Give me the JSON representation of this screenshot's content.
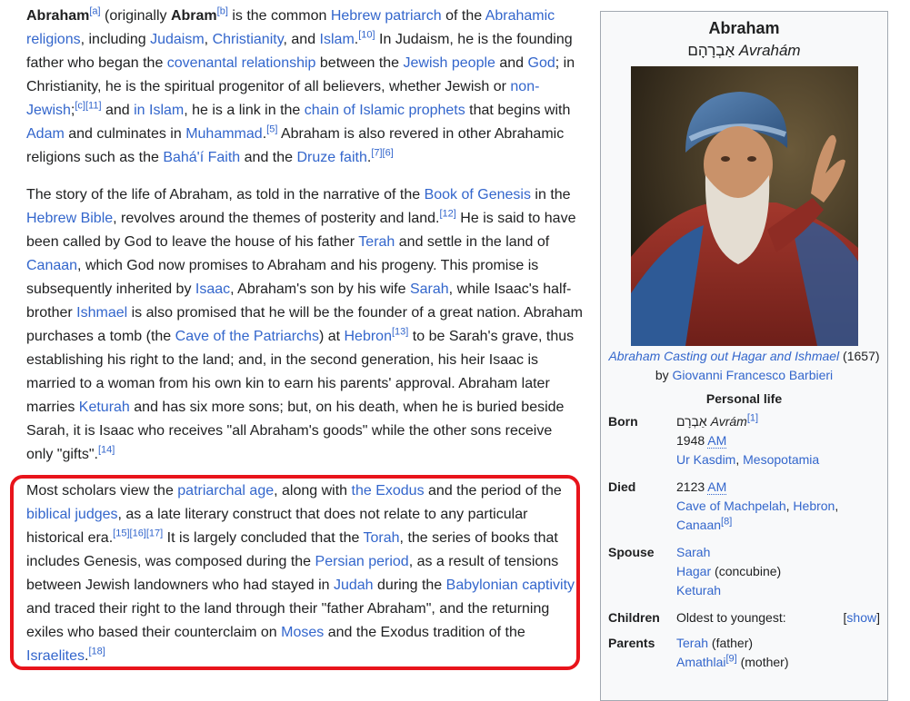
{
  "article": {
    "p1": [
      {
        "t": "Abraham",
        "b": 1
      },
      {
        "t": "[a]",
        "sup": 1,
        "l": 1
      },
      {
        "t": " (originally "
      },
      {
        "t": "Abram",
        "b": 1
      },
      {
        "t": "[b]",
        "sup": 1,
        "l": 1
      },
      {
        "t": " is the common "
      },
      {
        "t": "Hebrew patriarch",
        "l": 1
      },
      {
        "t": " of the "
      },
      {
        "t": "Abrahamic religions",
        "l": 1
      },
      {
        "t": ", including "
      },
      {
        "t": "Judaism",
        "l": 1
      },
      {
        "t": ", "
      },
      {
        "t": "Christianity",
        "l": 1
      },
      {
        "t": ", and "
      },
      {
        "t": "Islam",
        "l": 1
      },
      {
        "t": ".",
        "l": 0
      },
      {
        "t": "[10]",
        "sup": 1,
        "l": 1
      },
      {
        "t": " In Judaism, he is the founding father who began the "
      },
      {
        "t": "covenantal relationship",
        "l": 1
      },
      {
        "t": " between the "
      },
      {
        "t": "Jewish people",
        "l": 1
      },
      {
        "t": " and "
      },
      {
        "t": "God",
        "l": 1
      },
      {
        "t": "; in Christianity, he is the spiritual progenitor of all believers, whether Jewish or "
      },
      {
        "t": "non-Jewish",
        "l": 1
      },
      {
        "t": ";"
      },
      {
        "t": "[c]",
        "sup": 1,
        "l": 1
      },
      {
        "t": "[11]",
        "sup": 1,
        "l": 1
      },
      {
        "t": " and "
      },
      {
        "t": "in Islam",
        "l": 1
      },
      {
        "t": ", he is a link in the "
      },
      {
        "t": "chain of Islamic prophets",
        "l": 1
      },
      {
        "t": " that begins with "
      },
      {
        "t": "Adam",
        "l": 1
      },
      {
        "t": " and culminates in "
      },
      {
        "t": "Muhammad",
        "l": 1
      },
      {
        "t": "."
      },
      {
        "t": "[5]",
        "sup": 1,
        "l": 1
      },
      {
        "t": " Abraham is also revered in other Abrahamic religions such as the "
      },
      {
        "t": "Bahá'í Faith",
        "l": 1
      },
      {
        "t": " and the "
      },
      {
        "t": "Druze faith",
        "l": 1
      },
      {
        "t": "."
      },
      {
        "t": "[7]",
        "sup": 1,
        "l": 1
      },
      {
        "t": "[6]",
        "sup": 1,
        "l": 1
      }
    ],
    "p2": [
      {
        "t": "The story of the life of Abraham, as told in the narrative of the "
      },
      {
        "t": "Book of Genesis",
        "l": 1
      },
      {
        "t": " in the "
      },
      {
        "t": "Hebrew Bible",
        "l": 1
      },
      {
        "t": ", revolves around the themes of posterity and land."
      },
      {
        "t": "[12]",
        "sup": 1,
        "l": 1
      },
      {
        "t": " He is said to have been called by God to leave the house of his father "
      },
      {
        "t": "Terah",
        "l": 1
      },
      {
        "t": " and settle in the land of "
      },
      {
        "t": "Canaan",
        "l": 1
      },
      {
        "t": ", which God now promises to Abraham and his progeny. This promise is subsequently inherited by "
      },
      {
        "t": "Isaac",
        "l": 1
      },
      {
        "t": ", Abraham's son by his wife "
      },
      {
        "t": "Sarah",
        "l": 1
      },
      {
        "t": ", while Isaac's half-brother "
      },
      {
        "t": "Ishmael",
        "l": 1
      },
      {
        "t": " is also promised that he will be the founder of a great nation. Abraham purchases a tomb (the "
      },
      {
        "t": "Cave of the Patriarchs",
        "l": 1
      },
      {
        "t": ") at "
      },
      {
        "t": "Hebron",
        "l": 1
      },
      {
        "t": "[13]",
        "sup": 1,
        "l": 1
      },
      {
        "t": " to be Sarah's grave, thus establishing his right to the land; and, in the second generation, his heir Isaac is married to a woman from his own kin to earn his parents' approval. Abraham later marries "
      },
      {
        "t": "Keturah",
        "l": 1
      },
      {
        "t": " and has six more sons; but, on his death, when he is buried beside Sarah, it is Isaac who receives \"all Abraham's goods\" while the other sons receive only \"gifts\"."
      },
      {
        "t": "[14]",
        "sup": 1,
        "l": 1
      }
    ],
    "p3": [
      {
        "t": "Most scholars view the "
      },
      {
        "t": "patriarchal age",
        "l": 1
      },
      {
        "t": ", along with "
      },
      {
        "t": "the Exodus",
        "l": 1
      },
      {
        "t": " and the period of the "
      },
      {
        "t": "biblical judges",
        "l": 1
      },
      {
        "t": ", as a late literary construct that does not relate to any particular historical era."
      },
      {
        "t": "[15]",
        "sup": 1,
        "l": 1
      },
      {
        "t": "[16]",
        "sup": 1,
        "l": 1
      },
      {
        "t": "[17]",
        "sup": 1,
        "l": 1
      },
      {
        "t": " It is largely concluded that the "
      },
      {
        "t": "Torah",
        "l": 1
      },
      {
        "t": ", the series of books that includes Genesis, was composed during the "
      },
      {
        "t": "Persian period",
        "l": 1
      },
      {
        "t": ", as a result of tensions between Jewish landowners who had stayed in "
      },
      {
        "t": "Judah",
        "l": 1
      },
      {
        "t": " during the "
      },
      {
        "t": "Babylonian captivity",
        "l": 1
      },
      {
        "t": " and traced their right to the land through their \"father Abraham\", and the returning exiles who based their counterclaim on "
      },
      {
        "t": "Moses",
        "l": 1
      },
      {
        "t": " and the Exodus tradition of the "
      },
      {
        "t": "Israelites",
        "l": 1
      },
      {
        "t": "."
      },
      {
        "t": "[18]",
        "sup": 1,
        "l": 1
      }
    ]
  },
  "infobox": {
    "title": "Abraham",
    "native_hebrew": "אַבְרָהָם",
    "native_translit": "Avrahám",
    "caption_link": "Abraham Casting out Hagar and Ishmael",
    "caption_year": " (1657)",
    "caption_by": "by ",
    "caption_artist": "Giovanni Francesco Barbieri",
    "section": "Personal life",
    "born_label": "Born",
    "born_hebrew": "אַבְרָם",
    "born_translit": "Avrám",
    "born_ref": "[1]",
    "born_year": "1948 ",
    "born_era": "AM",
    "born_place1": "Ur Kasdim",
    "born_place2": "Mesopotamia",
    "died_label": "Died",
    "died_year": "2123 ",
    "died_era": "AM",
    "died_place1": "Cave of Machpelah",
    "died_place2": "Hebron",
    "died_place3": "Canaan",
    "died_ref": "[8]",
    "spouse_label": "Spouse",
    "spouse1": "Sarah",
    "spouse2": "Hagar",
    "spouse2_note": " (concubine)",
    "spouse3": "Keturah",
    "children_label": "Children",
    "children_val": "Oldest to youngest:",
    "show_open": "[",
    "show_text": "show",
    "show_close": "]",
    "parents_label": "Parents",
    "parent1": "Terah",
    "parent1_note": " (father)",
    "parent2": "Amathlai",
    "parent2_ref": "[9]",
    "parent2_note": " (mother)"
  },
  "colors": {
    "link": "#3366cc",
    "highlight": "#e8141b",
    "infobox_bg": "#f8f9fa"
  }
}
